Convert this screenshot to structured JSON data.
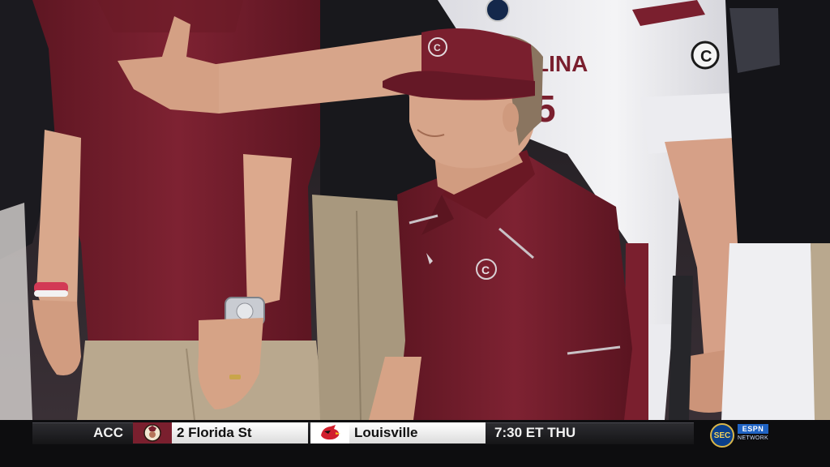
{
  "scene": {
    "colors": {
      "garnet": "#7a1f2e",
      "garnet_dark": "#5c1420",
      "jersey_white": "#f2f2f4",
      "skin": "#d7a58a",
      "khaki": "#b7a58b",
      "background": "#2a2226"
    },
    "logos": {
      "visor_logo": "gamecocks-C",
      "shirt_logo": "gamecocks-C",
      "jersey_patch": "sec-patch"
    }
  },
  "ticker": {
    "conference": "ACC",
    "team1": {
      "rank_name": "2 Florida St",
      "logo": "seminole-head-icon"
    },
    "team2": {
      "name": "Louisville",
      "logo": "cardinal-bird-icon"
    },
    "game_time": "7:30 ET THU",
    "network": {
      "sec": "SEC",
      "espn": "ESPN",
      "label": "NETWORK"
    }
  }
}
